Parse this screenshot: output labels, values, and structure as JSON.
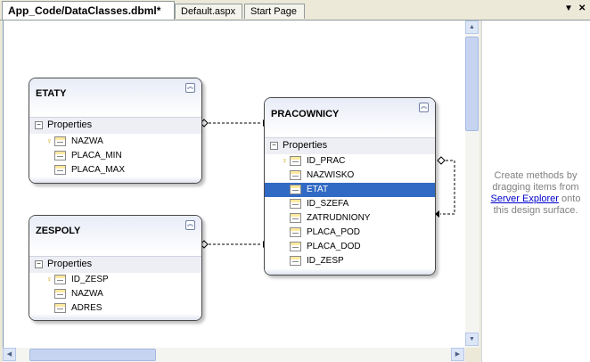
{
  "tabs": [
    {
      "label": "App_Code/DataClasses.dbml*",
      "active": true
    },
    {
      "label": "Default.aspx",
      "active": false
    },
    {
      "label": "Start Page",
      "active": false
    }
  ],
  "tab_controls": {
    "dropdown_icon": "triangle-down-icon",
    "close_icon": "x-icon",
    "dropdown_glyph": "▼",
    "close_glyph": "✕"
  },
  "entities": {
    "etaty": {
      "title": "ETATY",
      "section_label": "Properties",
      "properties": [
        {
          "name": "NAZWA",
          "key": true
        },
        {
          "name": "PLACA_MIN",
          "key": false
        },
        {
          "name": "PLACA_MAX",
          "key": false
        }
      ]
    },
    "zespoly": {
      "title": "ZESPOLY",
      "section_label": "Properties",
      "properties": [
        {
          "name": "ID_ZESP",
          "key": true
        },
        {
          "name": "NAZWA",
          "key": false
        },
        {
          "name": "ADRES",
          "key": false
        }
      ]
    },
    "pracownicy": {
      "title": "PRACOWNICY",
      "section_label": "Properties",
      "properties": [
        {
          "name": "ID_PRAC",
          "key": true
        },
        {
          "name": "NAZWISKO",
          "key": false
        },
        {
          "name": "ETAT",
          "key": false,
          "selected": true
        },
        {
          "name": "ID_SZEFA",
          "key": false
        },
        {
          "name": "ZATRUDNIONY",
          "key": false
        },
        {
          "name": "PLACA_POD",
          "key": false
        },
        {
          "name": "PLACA_DOD",
          "key": false
        },
        {
          "name": "ID_ZESP",
          "key": false
        }
      ]
    }
  },
  "methods_pane": {
    "text_before": "Create methods by dragging items from",
    "link": "Server Explorer",
    "text_after": "onto this design surface."
  },
  "colors": {
    "selection": "#316ac5",
    "link": "#0000cc"
  }
}
